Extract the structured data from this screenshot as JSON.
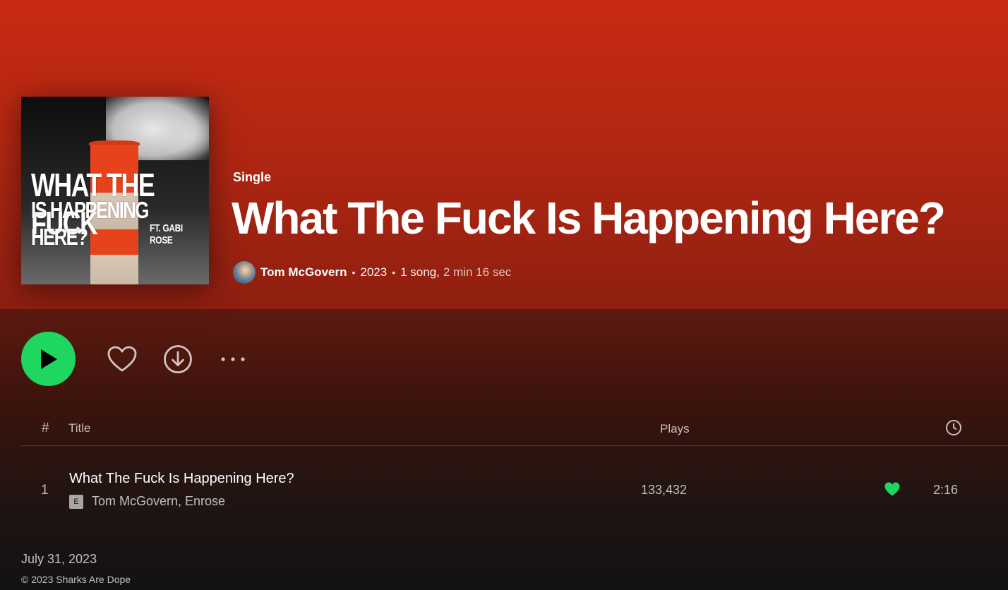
{
  "album": {
    "cover_text_line1": "WHAT THE FUCK",
    "cover_text_line2": "IS HAPPENING HERE?",
    "cover_text_line3": "FT. GABI ROSE",
    "type": "Single",
    "title": "What The Fuck Is Happening Here?",
    "artist": "Tom McGovern",
    "year": "2023",
    "song_count": "1 song,",
    "duration": "2 min 16 sec"
  },
  "controls": {
    "play_icon": "play-icon",
    "like_icon": "heart-outline-icon",
    "download_icon": "download-icon",
    "more_icon": "more-icon"
  },
  "table": {
    "header": {
      "number": "#",
      "title": "Title",
      "plays": "Plays",
      "duration_icon": "clock-icon"
    },
    "tracks": [
      {
        "number": "1",
        "title": "What The Fuck Is Happening Here?",
        "explicit_label": "E",
        "artists": "Tom McGovern, Enrose",
        "plays": "133,432",
        "duration": "2:16",
        "liked": true
      }
    ]
  },
  "footer": {
    "release_date": "July 31, 2023",
    "copyright": "© 2023 Sharks Are Dope"
  },
  "colors": {
    "accent": "#1ed760",
    "hero": "#c82a12",
    "background": "#121212"
  }
}
